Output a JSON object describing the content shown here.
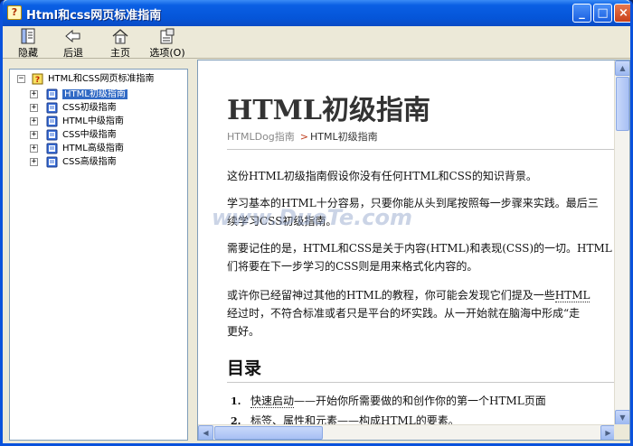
{
  "window": {
    "title": "Html和css网页标准指南",
    "minimize": "_",
    "maximize": "□",
    "close": "×"
  },
  "toolbar": {
    "hide_label": "隐藏",
    "back_label": "后退",
    "home_label": "主页",
    "options_label": "选项(O)"
  },
  "tree": {
    "root": "HTML和CSS网页标准指南",
    "items": [
      {
        "label": "HTML初级指南",
        "selected": true
      },
      {
        "label": "CSS初级指南"
      },
      {
        "label": "HTML中级指南"
      },
      {
        "label": "CSS中级指南"
      },
      {
        "label": "HTML高级指南"
      },
      {
        "label": "CSS高级指南"
      }
    ]
  },
  "content": {
    "title": "HTML初级指南",
    "breadcrumb": {
      "parent": "HTMLDog指南",
      "sep": ">",
      "current": "HTML初级指南"
    },
    "p1": "这份HTML初级指南假设你没有任何HTML和CSS的知识背景。",
    "p2_line1": "学习基本的HTML十分容易，只要你能从头到尾按照每一步骤来实践。最后三",
    "p2_line2": "续学习CSS初级指南。",
    "p3_line1": "需要记住的是，HTML和CSS是关于内容(HTML)和表现(CSS)的一切。HTML",
    "p3_line2": "们将要在下一步学习的CSS则是用来格式化内容的。",
    "p4_line1_pre": "或许你已经留神过其他的HTML的教程，你可能会发现它们提及一些",
    "p4_line1_link": "HTML",
    "p4_line2": "经过时，不符合标准或者只是平台的坏实践。从一开始就在脑海中形成“走",
    "p4_line3": "更好。",
    "toc_heading": "目录",
    "toc": [
      {
        "num": "1.",
        "link": "快速启动",
        "rest": "——开始你所需要做的和创作你的第一个HTML页面"
      },
      {
        "num": "2.",
        "link": "标签、属性和元素",
        "rest": "——构成HTML的要素。"
      }
    ]
  },
  "watermark": "www.DuoTe.com",
  "colors": {
    "titlebar": "#0555d8",
    "selection": "#316ac5",
    "window_bg": "#ece9d8"
  }
}
